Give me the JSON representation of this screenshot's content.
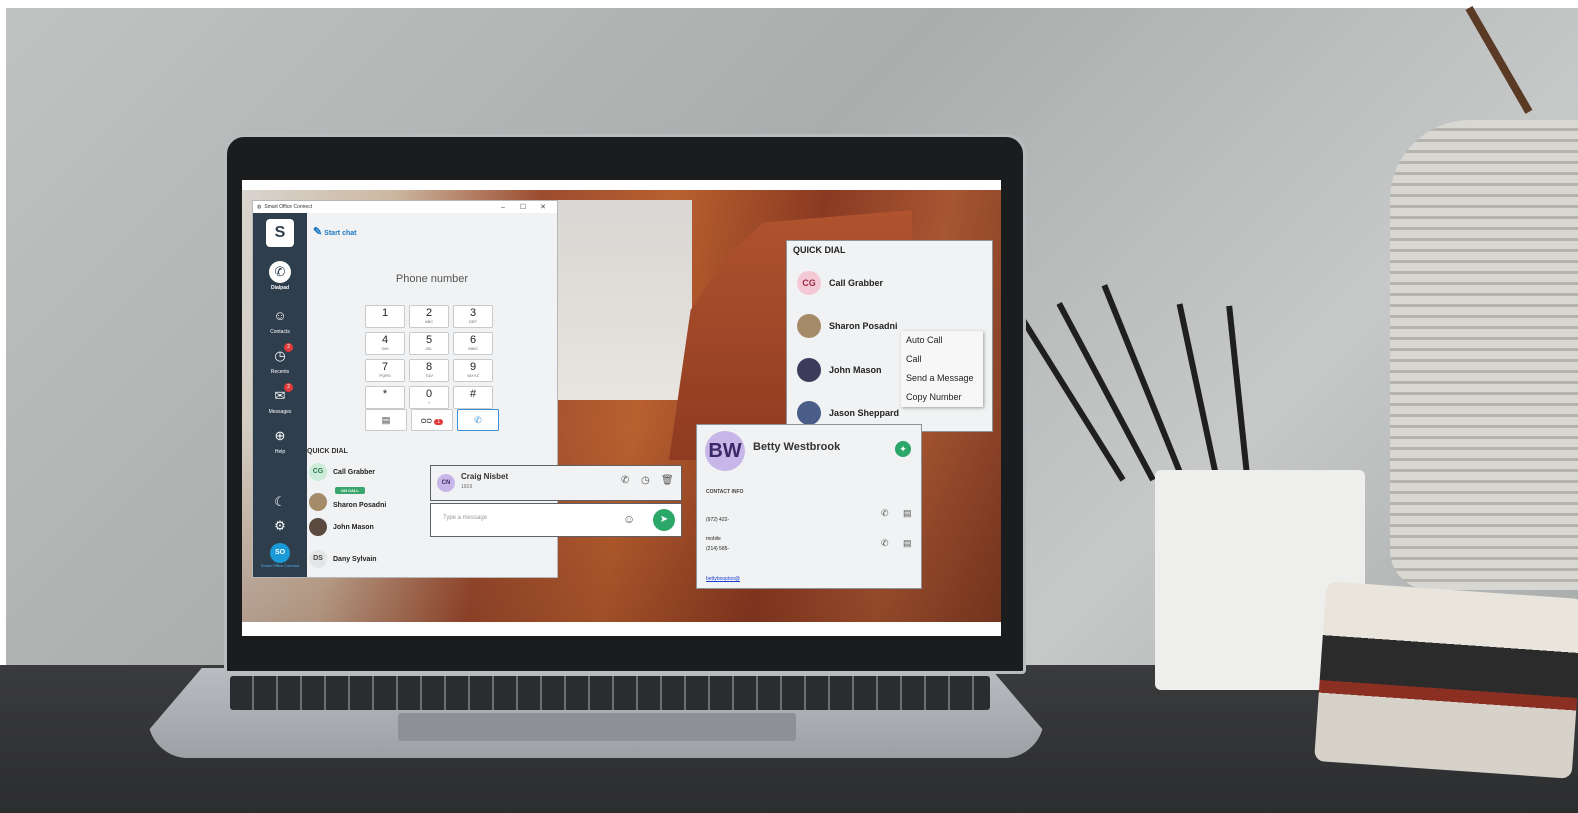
{
  "app": {
    "window_title": "Smart Office Connect",
    "controls": {
      "minimize": "–",
      "maximize": "☐",
      "close": "✕"
    },
    "start_chat": "Start chat",
    "phone_placeholder": "Phone number",
    "nav": [
      {
        "label": "Dialpad",
        "icon": "phone-icon"
      },
      {
        "label": "Contacts",
        "icon": "contact-icon"
      },
      {
        "label": "Recents",
        "icon": "history-icon",
        "badge": "2"
      },
      {
        "label": "Messages",
        "icon": "message-icon",
        "badge": "2"
      },
      {
        "label": "Help",
        "icon": "globe-icon"
      }
    ],
    "avatar": {
      "initials": "SO",
      "label": "Smart Office Connect"
    },
    "keypad": [
      {
        "digit": "1",
        "letters": ""
      },
      {
        "digit": "2",
        "letters": "ABC"
      },
      {
        "digit": "3",
        "letters": "DEF"
      },
      {
        "digit": "4",
        "letters": "GHI"
      },
      {
        "digit": "5",
        "letters": "JKL"
      },
      {
        "digit": "6",
        "letters": "MNO"
      },
      {
        "digit": "7",
        "letters": "PQRS"
      },
      {
        "digit": "8",
        "letters": "TUV"
      },
      {
        "digit": "9",
        "letters": "WXYZ"
      },
      {
        "digit": "*",
        "letters": ""
      },
      {
        "digit": "0",
        "letters": "+"
      },
      {
        "digit": "#",
        "letters": ""
      }
    ],
    "voicemail_badge": "1",
    "quick_dial_title": "QUICK DIAL",
    "quick_dial": [
      {
        "initials": "CG",
        "name": "Call Grabber"
      },
      {
        "name": "Sharon Posadni",
        "status": "ON CALL"
      },
      {
        "name": "John Mason"
      },
      {
        "initials": "DS",
        "name": "Dany Sylvain"
      }
    ]
  },
  "chat": {
    "initials": "CN",
    "name": "Craig Nisbet",
    "number": "1919",
    "placeholder": "Type a message"
  },
  "quick_dial_panel": {
    "title": "QUICK DIAL",
    "rows": [
      {
        "initials": "CG",
        "name": "Call Grabber"
      },
      {
        "name": "Sharon Posadni"
      },
      {
        "name": "John Mason"
      },
      {
        "name": "Jason Sheppard"
      }
    ],
    "context_menu": [
      "Auto Call",
      "Call",
      "Send a Message",
      "Copy Number"
    ]
  },
  "contact_card": {
    "initials": "BW",
    "name": "Betty Westbrook",
    "section": "CONTACT INFO",
    "phone1": "(972) 422-",
    "mobile_label": "mobile",
    "phone2": "(214) 585-",
    "email": "bettybooptoo@"
  },
  "colors": {
    "rail": "#2f3e4d",
    "accent_blue": "#1a76c2",
    "green": "#2ca76a",
    "badge_red": "#e03a3a",
    "avatar_purple": "#c9b6e8"
  }
}
